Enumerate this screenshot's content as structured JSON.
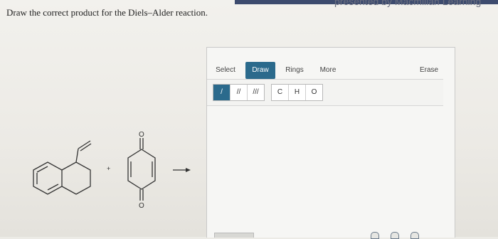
{
  "header": {
    "credit": "presented by Macmillan Learning"
  },
  "question": {
    "text": "Draw the correct product for the Diels–Alder reaction."
  },
  "reaction": {
    "plus": "+",
    "oxygen_label": "O"
  },
  "toolbar": {
    "tabs": [
      {
        "label": "Select"
      },
      {
        "label": "Draw"
      },
      {
        "label": "Rings"
      },
      {
        "label": "More"
      },
      {
        "label": "Erase"
      }
    ],
    "bond_buttons": [
      "/",
      "//",
      "///"
    ],
    "atom_buttons": [
      "C",
      "H",
      "O"
    ]
  },
  "colors": {
    "accent": "#2b6a8c",
    "topbar": "#3d4b6e"
  }
}
